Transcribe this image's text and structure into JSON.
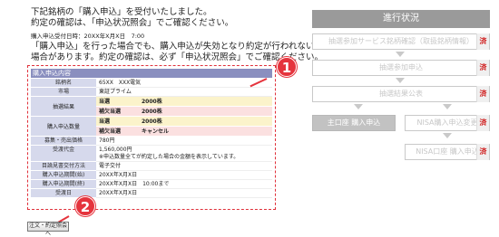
{
  "message": {
    "line1": "下記銘柄の「購入申込」を受付いたしました。",
    "line2": "約定の確認は、「申込状況照会」でご確認ください。",
    "date": "購入申込受付日時：20XX年X月X日　7:00",
    "note1": "「購入申込」を行った場合でも、購入申込が失効となり約定が行われない",
    "note2": "場合があります。約定の確認は、必ず「申込状況照会」でご確認ください。"
  },
  "detail": {
    "header": "購入申込内容",
    "rows": [
      {
        "label": "銘柄名",
        "value": "65XX　XXX電気"
      },
      {
        "label": "市場",
        "value": "東証プライム"
      }
    ],
    "lottery": {
      "label": "抽選結果",
      "main": {
        "k": "当選",
        "v": "2000株"
      },
      "sub": {
        "k": "補欠当選",
        "v": "2000株"
      }
    },
    "quantity": {
      "label": "購入申込数量",
      "main": {
        "k": "当選",
        "v": "2000株"
      },
      "sub": {
        "k": "補欠当選",
        "v": "キャンセル"
      }
    },
    "rows2": [
      {
        "label": "募集・売出価格",
        "value": "780円"
      },
      {
        "label": "受渡代金",
        "value": "1,560,000円",
        "note": "※申込数量全てが約定した場合の金額を表示しています。"
      },
      {
        "label": "目論見書交付方法",
        "value": "電子交付"
      },
      {
        "label": "購入申込期間(始)",
        "value": "20XX年X月X日"
      },
      {
        "label": "購入申込期間(終)",
        "value": "20XX年X月X日　10:00まで"
      },
      {
        "label": "受渡日",
        "value": "20XX年X月X日"
      }
    ]
  },
  "order_button": "注文・約定照会へ",
  "markers": {
    "one": "1",
    "two": "2"
  },
  "progress": {
    "title": "進行状況",
    "steps": [
      "抽選参加サービス銘柄確認（取扱銘柄情報）",
      "抽選参加申込",
      "抽選結果公表",
      "主口座 購入申込",
      "NISA購入申込変更",
      "NISA口座 購入申込"
    ],
    "done_label": "済"
  },
  "colors": {
    "accent": "#e5343d",
    "header": "#8a8fbf",
    "label_bg": "#d6d9ec",
    "winner": "#fbf3cb",
    "alt": "#fbe0e0"
  }
}
